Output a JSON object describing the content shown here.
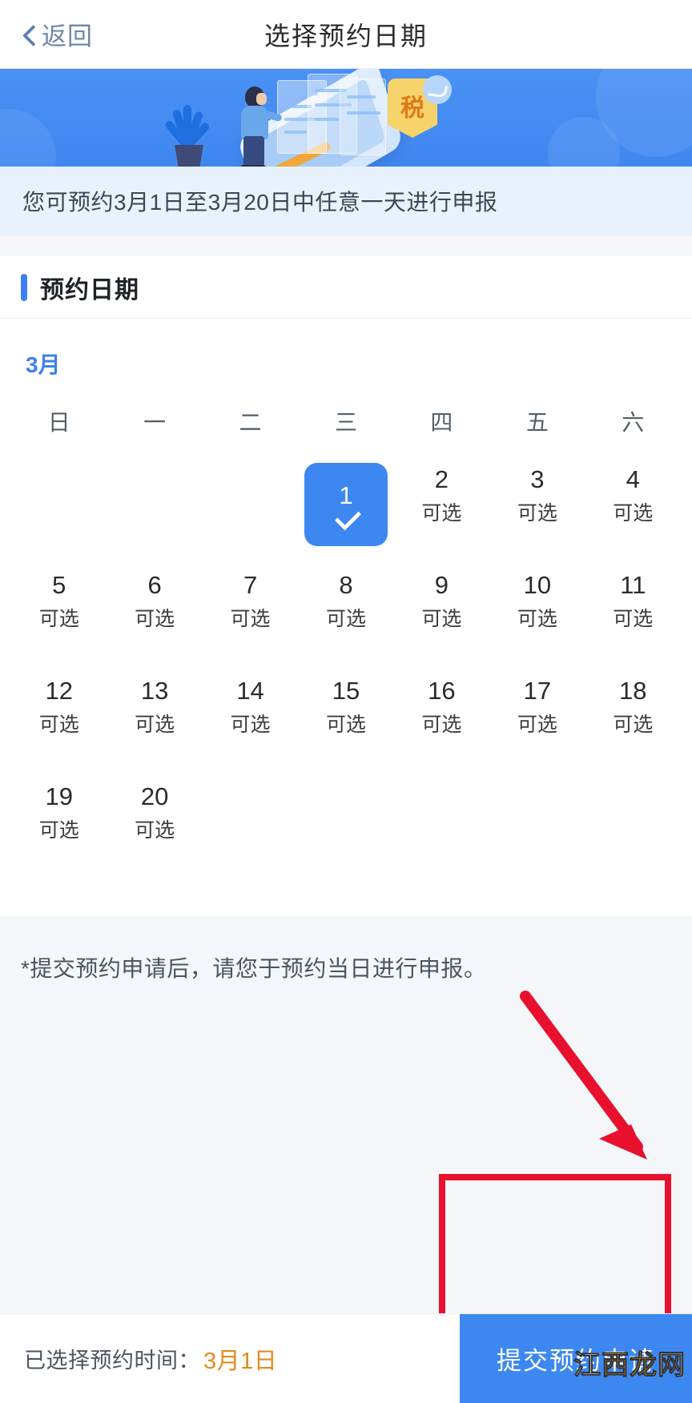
{
  "navbar": {
    "back_label": "返回",
    "title": "选择预约日期",
    "back_icon": "chevron-left-icon"
  },
  "banner": {
    "tax_badge_text": "税",
    "chevron_count": 5,
    "colors": {
      "bg": "#4a91f5",
      "badge": "#f7d36b",
      "badge_text": "#e07a17",
      "accent_bar": "#f0a73c"
    }
  },
  "infobar": {
    "text": "您可预约3月1日至3月20日中任意一天进行申报"
  },
  "section": {
    "title": "预约日期",
    "accent_color": "#3d7ff0"
  },
  "calendar": {
    "month_label": "3月",
    "weekdays": [
      "日",
      "一",
      "二",
      "三",
      "四",
      "五",
      "六"
    ],
    "leading_blanks": 3,
    "available_label": "可选",
    "selected_day": "1",
    "selected_color": "#3d88f0",
    "days": [
      {
        "num": "1",
        "status": "可选",
        "selected": true
      },
      {
        "num": "2",
        "status": "可选",
        "selected": false
      },
      {
        "num": "3",
        "status": "可选",
        "selected": false
      },
      {
        "num": "4",
        "status": "可选",
        "selected": false
      },
      {
        "num": "5",
        "status": "可选",
        "selected": false
      },
      {
        "num": "6",
        "status": "可选",
        "selected": false
      },
      {
        "num": "7",
        "status": "可选",
        "selected": false
      },
      {
        "num": "8",
        "status": "可选",
        "selected": false
      },
      {
        "num": "9",
        "status": "可选",
        "selected": false
      },
      {
        "num": "10",
        "status": "可选",
        "selected": false
      },
      {
        "num": "11",
        "status": "可选",
        "selected": false
      },
      {
        "num": "12",
        "status": "可选",
        "selected": false
      },
      {
        "num": "13",
        "status": "可选",
        "selected": false
      },
      {
        "num": "14",
        "status": "可选",
        "selected": false
      },
      {
        "num": "15",
        "status": "可选",
        "selected": false
      },
      {
        "num": "16",
        "status": "可选",
        "selected": false
      },
      {
        "num": "17",
        "status": "可选",
        "selected": false
      },
      {
        "num": "18",
        "status": "可选",
        "selected": false
      },
      {
        "num": "19",
        "status": "可选",
        "selected": false
      },
      {
        "num": "20",
        "status": "可选",
        "selected": false
      }
    ]
  },
  "footnote": {
    "text": "*提交预约申请后，请您于预约当日进行申报。"
  },
  "bottombar": {
    "selected_label": "已选择预约时间：",
    "selected_value": "3月1日",
    "submit_label": "提交预约申请",
    "submit_color": "#3d88f0",
    "value_color": "#e38a1c"
  },
  "annotations": {
    "arrow_color": "#e8112d",
    "rect_color": "#e8112d"
  },
  "watermark": {
    "chars": [
      "江",
      "西",
      "龙",
      "网"
    ]
  }
}
